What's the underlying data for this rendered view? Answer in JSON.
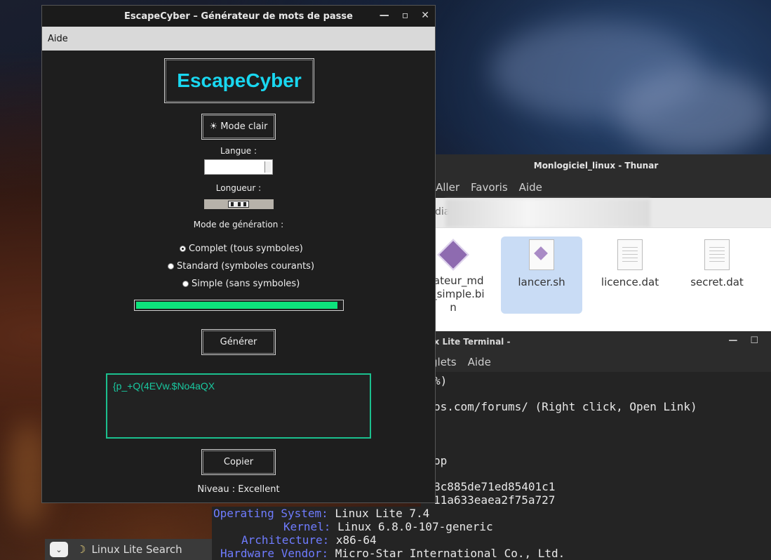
{
  "thunar": {
    "title": "Monlogiciel_linux - Thunar",
    "menu": [
      "Aller",
      "Favoris",
      "Aide"
    ],
    "path_fragment": "dia",
    "files": [
      {
        "name": "erateur_md\nui_simple.bi\nn"
      },
      {
        "name": "lancer.sh"
      },
      {
        "name": "licence.dat"
      },
      {
        "name": "secret.dat"
      }
    ]
  },
  "terminal": {
    "title": "ux Lite Terminal -",
    "menu": [
      "glets",
      "Aide"
    ],
    "lines": [
      "%)",
      "os.com/forums/ (Right click, Open Link)",
      "op",
      "8c885de71ed85401c1",
      "11a633eaea2f75a727"
    ],
    "info": [
      {
        "key": "Operating System:",
        "value": "Linux Lite 7.4"
      },
      {
        "key": "Kernel:",
        "value": "Linux 6.8.0-107-generic"
      },
      {
        "key": "Architecture:",
        "value": "x86-64"
      },
      {
        "key": "Hardware Vendor:",
        "value": "Micro-Star International Co., Ltd."
      }
    ]
  },
  "taskbar": {
    "search_label": "Linux Lite Search"
  },
  "app": {
    "title": "EscapeCyber – Générateur de mots de passe",
    "menu_help": "Aide",
    "logo": "EscapeCyber",
    "theme_button": "☀ Mode clair",
    "language_label": "Langue :",
    "language_value": "",
    "length_label": "Longueur :",
    "mode_label": "Mode de génération :",
    "modes": [
      {
        "label": "Complet (tous symboles)",
        "selected": true
      },
      {
        "label": "Standard (symboles courants)",
        "selected": false
      },
      {
        "label": "Simple (sans symboles)",
        "selected": false
      }
    ],
    "strength_fill": 0.98,
    "strength_color": "#0de37c",
    "generate_button": "Générer",
    "password": "{p_+Q(4EVw.$No4aQX",
    "copy_button": "Copier",
    "level_text": "Niveau : Excellent",
    "accent_color": "#19d7f0",
    "output_border_color": "#1bc08e"
  }
}
